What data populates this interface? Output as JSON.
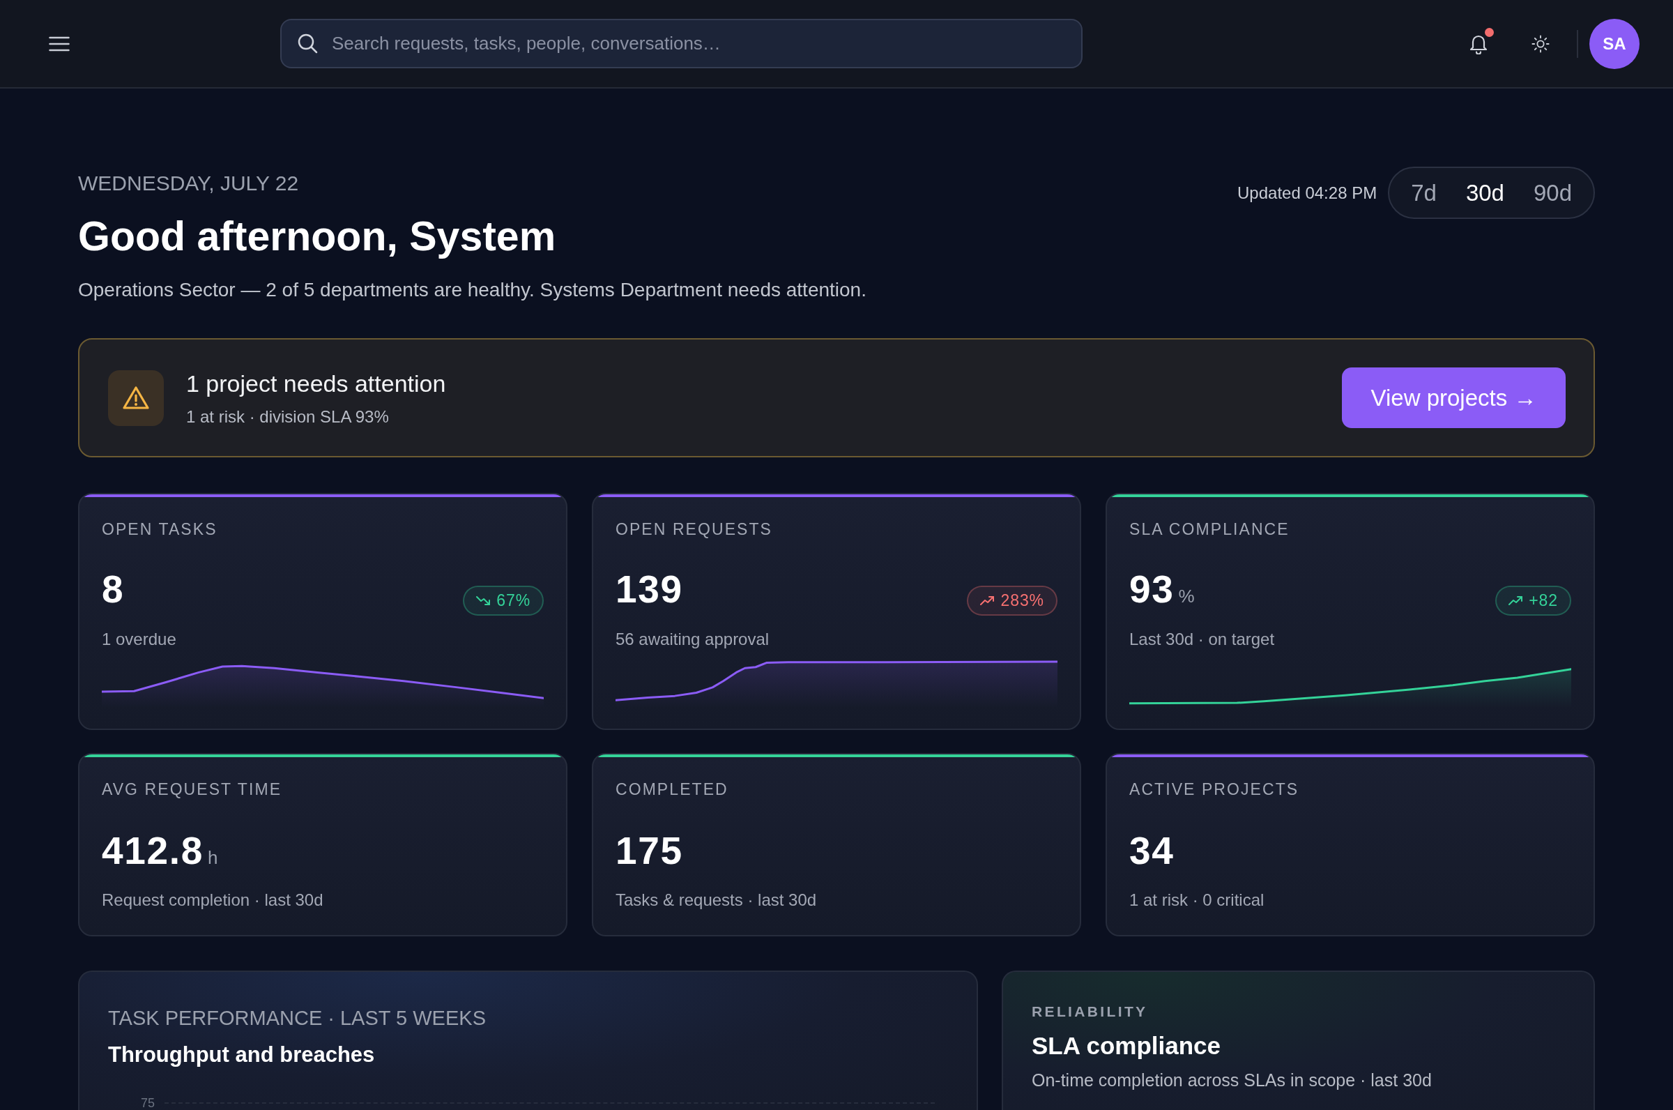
{
  "topbar": {
    "search": {
      "placeholder": "Search requests, tasks, people, conversations…"
    },
    "notifications": {
      "unread": true
    },
    "avatar": {
      "initials": "SA"
    }
  },
  "header": {
    "date": "WEDNESDAY, JULY 22",
    "title": "Good afternoon, System",
    "subtitle": "Operations Sector — 2 of 5 departments are healthy. Systems Department needs attention.",
    "updated": "Updated 04:28 PM",
    "ranges": [
      {
        "label": "7d",
        "selected": false
      },
      {
        "label": "30d",
        "selected": true
      },
      {
        "label": "90d",
        "selected": false
      }
    ]
  },
  "alert": {
    "title": "1 project needs attention",
    "detail": "1 at risk · division SLA 93%",
    "action": "View projects →"
  },
  "stats": [
    {
      "kind": "sparkline",
      "label": "OPEN TASKS",
      "value": "8",
      "detail": "1 overdue",
      "color": "#8b5cf6",
      "badge": {
        "kind": "down",
        "text": "67%",
        "color": "#34d399"
      },
      "sparkline": {
        "kind": "hump"
      }
    },
    {
      "kind": "sparkline",
      "label": "OPEN REQUESTS",
      "value": "139",
      "detail": "56 awaiting approval",
      "color": "#8b5cf6",
      "badge": {
        "kind": "up",
        "text": "283%",
        "color": "#f87171"
      },
      "sparkline": {
        "kind": "plateau"
      }
    },
    {
      "kind": "sparkline",
      "label": "SLA COMPLIANCE",
      "value": "93",
      "unit": "%",
      "detail": "Last 30d · on target",
      "color": "#34d399",
      "badge": {
        "kind": "up",
        "text": "+82",
        "color": "#34d399"
      },
      "sparkline": {
        "kind": "rise"
      }
    },
    {
      "kind": "plain",
      "label": "AVG REQUEST TIME",
      "value": "412.8",
      "unit": "h",
      "detail": "Request completion · last 30d",
      "color": "#34d399"
    },
    {
      "kind": "plain",
      "label": "COMPLETED",
      "value": "175",
      "detail": "Tasks & requests · last 30d",
      "color": "#34d399"
    },
    {
      "kind": "plain",
      "label": "ACTIVE PROJECTS",
      "value": "34",
      "detail": "1 at risk · 0 critical",
      "color": "#8b5cf6"
    }
  ],
  "panels": [
    {
      "kind": "chart",
      "eyebrow": "TASK PERFORMANCE · LAST 5 WEEKS",
      "title": "Throughput and breaches",
      "axis_ticks": [
        "75"
      ]
    },
    {
      "kind": "summary",
      "eyebrow": "RELIABILITY",
      "title": "SLA compliance",
      "description": "On-time completion across SLAs in scope · last 30d"
    }
  ]
}
